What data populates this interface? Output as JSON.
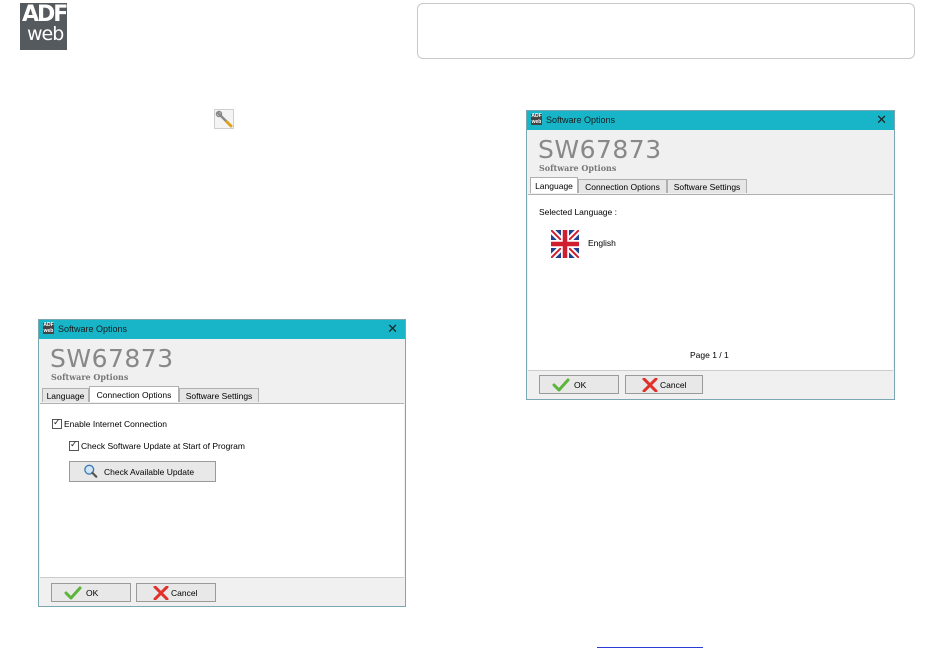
{
  "logo": {
    "line1": "ADF",
    "line2": "web"
  },
  "left_dialog": {
    "title": "Software Options",
    "close": "✕",
    "app_code": "SW67873",
    "subtitle": "Software Options",
    "tabs": [
      "Language",
      "Connection Options",
      "Software Settings"
    ],
    "active_tab": "Connection Options",
    "enable_internet": "Enable Internet Connection",
    "check_update_start": "Check Software Update at Start of Program",
    "check_button": "Check Available Update",
    "ok": "OK",
    "cancel": "Cancel"
  },
  "right_dialog": {
    "title": "Software Options",
    "close": "✕",
    "app_code": "SW67873",
    "subtitle": "Software Options",
    "tabs": [
      "Language",
      "Connection Options",
      "Software Settings"
    ],
    "active_tab": "Language",
    "selected_language_label": "Selected Language :",
    "language": "English",
    "page": "Page 1 / 1",
    "ok": "OK",
    "cancel": "Cancel"
  },
  "colors": {
    "titlebar": "#17b5c7",
    "link": "#2a3bd6"
  }
}
